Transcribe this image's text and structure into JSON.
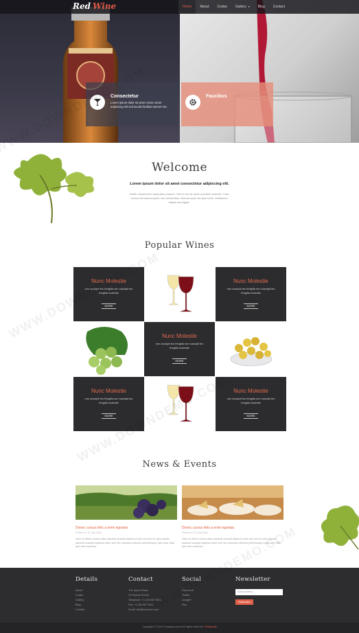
{
  "brand": {
    "word1": "Red",
    "word2": "Wine"
  },
  "nav": [
    {
      "label": "Home",
      "active": true
    },
    {
      "label": "About"
    },
    {
      "label": "Codes"
    },
    {
      "label": "Gallery",
      "caret": "▾"
    },
    {
      "label": "Blog"
    },
    {
      "label": "Contact"
    }
  ],
  "hero": {
    "left": {
      "title": "Consectetur",
      "text": "Lorem ipsum dolor sit amet conse ctetur adipiscing elit sed iaculis facilisis laoreet nec"
    },
    "right": {
      "title": "Faucibus"
    }
  },
  "welcome": {
    "title": "Welcome",
    "subtitle": "Lorem ipsum dolor sit amet consectetur adipiscing elit.",
    "text": "Vestib ulumfermen imperdiet posuere. Sed et dui sit amet convallis molestie. Cras cursus elementum justo non elementum. Aenean quis nisi quis tortor vestibulum aliquet sed ligula."
  },
  "popular": {
    "title": "Popular Wines",
    "cards": [
      {
        "title": "Nunc Molestie",
        "text": "non suscipit leo fringilla non suscipit leo fringilla molestie",
        "more": "MORE"
      },
      {
        "title": "Nunc Molestie",
        "text": "non suscipit leo fringilla non suscipit leo fringilla molestie",
        "more": "MORE"
      },
      {
        "title": "Nunc Molestie",
        "text": "non suscipit leo fringilla non suscipit leo fringilla molestie",
        "more": "MORE"
      },
      {
        "title": "Nunc Molestie",
        "text": "non suscipit leo fringilla non suscipit leo fringilla molestie",
        "more": "MORE"
      },
      {
        "title": "Nunc Molestie",
        "text": "non suscipit leo fringilla non suscipit leo fringilla molestie",
        "more": "MORE"
      }
    ]
  },
  "news": {
    "title": "News & Events",
    "items": [
      {
        "title": "Donec cursus felis a enim egestas",
        "meta": "Posted on: 21 July 2015",
        "text": "Nam ex libero cursus vitae placerat suscipit dapibus tortor sed sed ex quis lacinia placerat suscipit dapibus tortor sed nec maximus ultricies pellentesque quis ante vitae quis sed maximus"
      },
      {
        "title": "Donec cursus felis a enim egestas",
        "meta": "Posted on: 21 July 2015",
        "text": "Nam ex libero cursus vitae placerat suscipit dapibus tortor sed sed ex quis lacinia placerat suscipit dapibus tortor sed nec maximus ultricies pellentesque quis ante vitae quis sed maximus"
      }
    ]
  },
  "footer": {
    "details": {
      "title": "Details",
      "items": [
        "About",
        "Codes",
        "Gallery",
        "Blog",
        "Contact"
      ]
    },
    "contact": {
      "title": "Contact",
      "items": [
        "The Ipsum Plaza",
        "22 Rossini St NAL",
        "Telephone: +1 234 567 8901",
        "Fax: +1 234 567 8901",
        "Email: info@example.com"
      ]
    },
    "social": {
      "title": "Social",
      "items": [
        "Facebook",
        "Twitter",
        "Google+",
        "Rss"
      ]
    },
    "newsletter": {
      "title": "Newsletter",
      "placeholder": "Email address",
      "button": "Subscribe"
    },
    "copyright": "Copyright © 2015 Company name All rights reserved.",
    "copyright_brand": "W3layouts"
  },
  "watermark": "WWW.DOWNDEMO.COM",
  "colors": {
    "accent": "#e0604a",
    "dark": "#2c2c2e",
    "nav_bg": "#141418"
  }
}
